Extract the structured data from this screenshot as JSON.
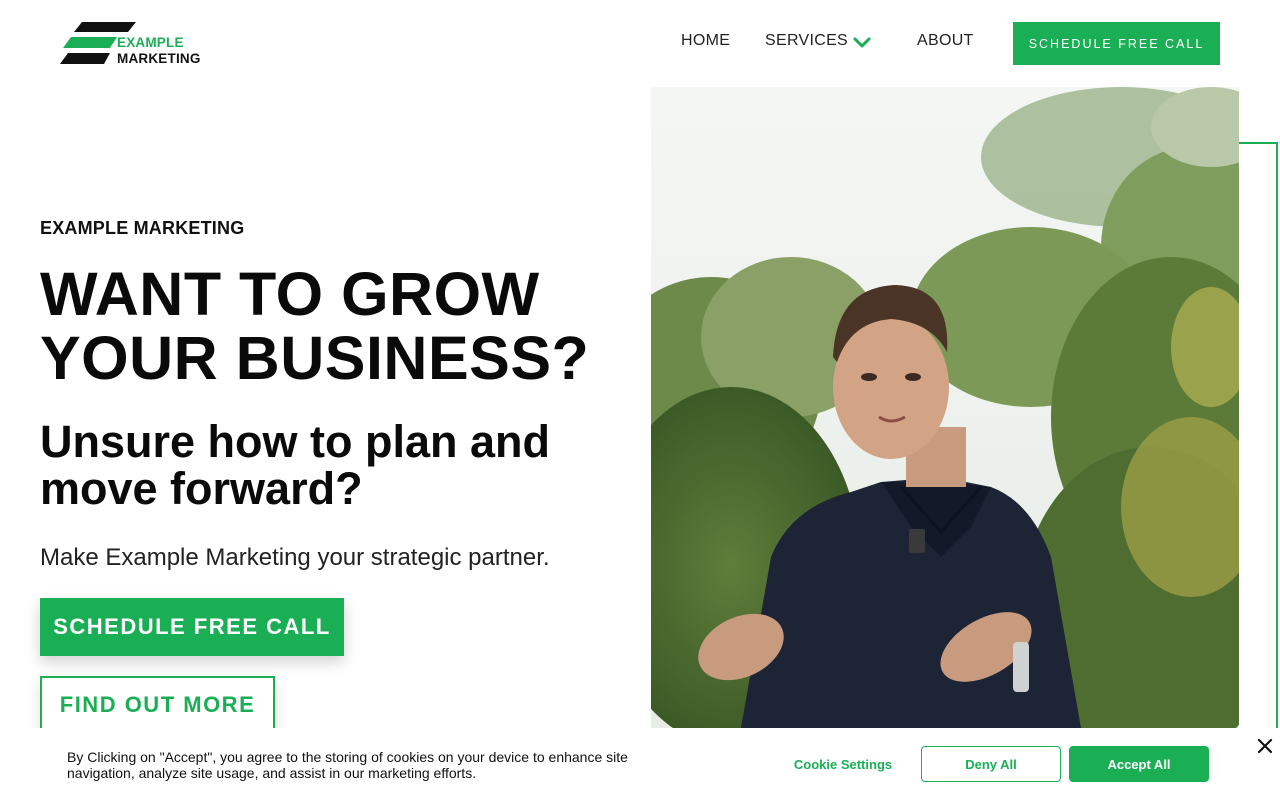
{
  "brand": {
    "logo_line1": "EXAMPLE",
    "logo_line2": "MARKETING",
    "logo_icon": "stacked-bars-logo-icon",
    "accent_color": "#1aaf55",
    "dark_color": "#111111"
  },
  "nav": {
    "home": "HOME",
    "services": "SERVICES",
    "services_icon": "chevron-down-icon",
    "about": "ABOUT",
    "cta": "SCHEDULE FREE CALL"
  },
  "hero": {
    "eyebrow": "EXAMPLE MARKETING",
    "headline_line1": "WANT TO GROW",
    "headline_line2": "YOUR BUSINESS?",
    "subhead_line1": "Unsure how to plan and",
    "subhead_line2": "move forward?",
    "tagline": "Make Example Marketing your strategic partner.",
    "primary_cta": "SCHEDULE FREE CALL",
    "secondary_cta": "FIND OUT MORE",
    "media": "video-still-presenter-outdoors"
  },
  "cookie_banner": {
    "text": "By Clicking on \"Accept\", you agree to the storing of cookies on your device to enhance site navigation, analyze site usage, and assist in our marketing efforts.",
    "settings": "Cookie Settings",
    "deny": "Deny All",
    "accept": "Accept All",
    "close_icon": "close-icon"
  }
}
